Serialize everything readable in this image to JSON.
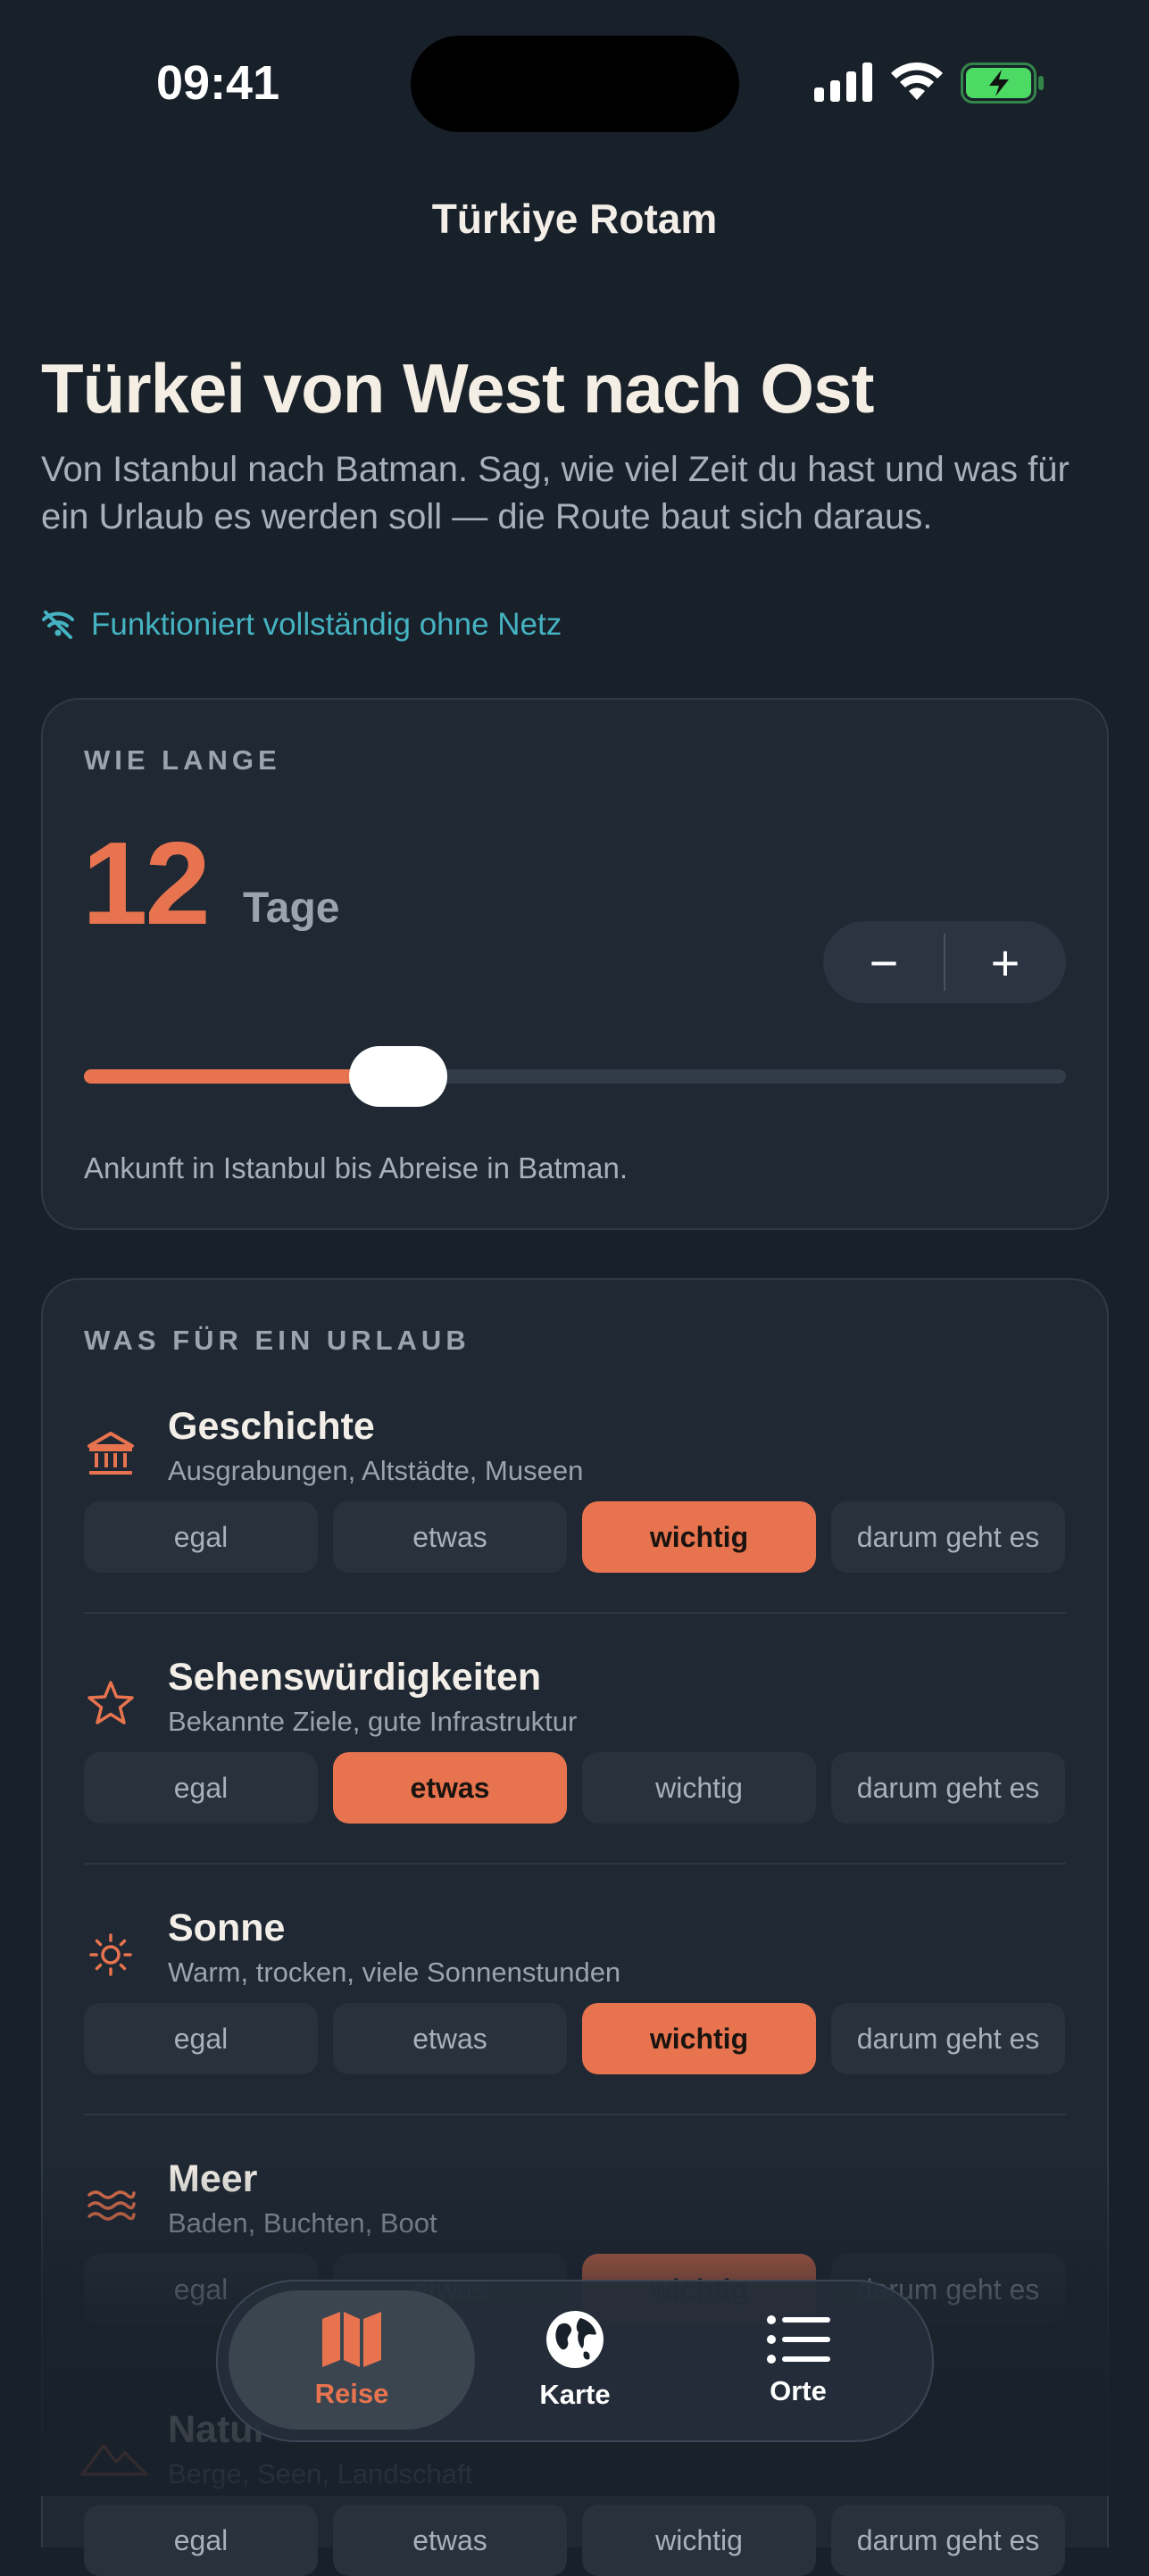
{
  "status": {
    "time": "09:41"
  },
  "app": {
    "title": "Türkiye Rotam"
  },
  "hero": {
    "title": "Türkei von West nach Ost",
    "subtitle": "Von Istanbul nach Batman. Sag, wie viel Zeit du hast und was für ein Urlaub es werden soll — die Route baut sich daraus.",
    "offline_note": "Funktioniert vollständig ohne Netz"
  },
  "duration": {
    "label": "WIE LANGE",
    "days": "12",
    "unit": "Tage",
    "minus": "−",
    "plus": "+",
    "slider_fraction": 0.32,
    "note": "Ankunft in Istanbul bis Abreise in Batman."
  },
  "vacation": {
    "label": "WAS FÜR EIN URLAUB",
    "options": [
      "egal",
      "etwas",
      "wichtig",
      "darum geht es"
    ],
    "categories": [
      {
        "title": "Geschichte",
        "subtitle": "Ausgrabungen, Altstädte, Museen",
        "icon": "museum-icon",
        "selected": 2
      },
      {
        "title": "Sehenswürdigkeiten",
        "subtitle": "Bekannte Ziele, gute Infrastruktur",
        "icon": "star-icon",
        "selected": 1
      },
      {
        "title": "Sonne",
        "subtitle": "Warm, trocken, viele Sonnenstunden",
        "icon": "sun-icon",
        "selected": 2
      },
      {
        "title": "Meer",
        "subtitle": "Baden, Buchten, Boot",
        "icon": "waves-icon",
        "selected": 2
      },
      {
        "title": "Natur",
        "subtitle": "Berge, Seen, Landschaft",
        "icon": "mountain-icon",
        "selected": null
      }
    ]
  },
  "tabs": [
    {
      "label": "Reise",
      "icon": "map-icon",
      "active": true
    },
    {
      "label": "Karte",
      "icon": "globe-icon",
      "active": false
    },
    {
      "label": "Orte",
      "icon": "list-icon",
      "active": false
    }
  ],
  "colors": {
    "accent": "#e8734f",
    "teal": "#45b3c2",
    "background": "#18202a",
    "card": "#1f2833"
  }
}
